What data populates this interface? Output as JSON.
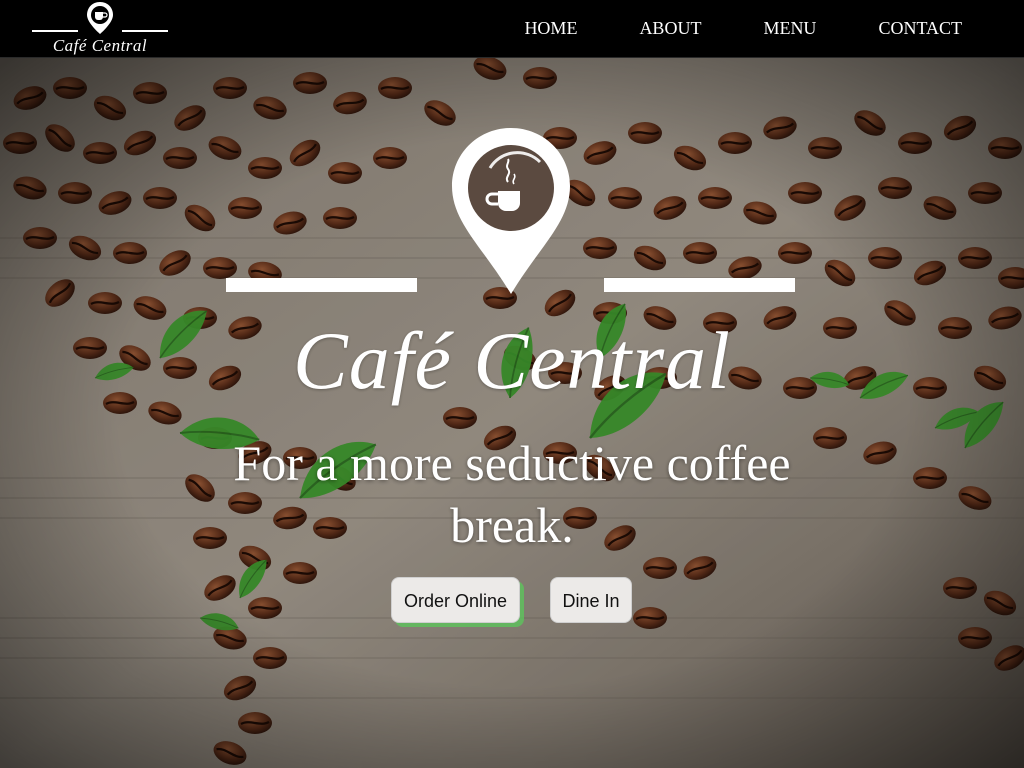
{
  "nav": {
    "logo_text": "Café Central",
    "links": [
      {
        "label": "HOME"
      },
      {
        "label": "ABOUT"
      },
      {
        "label": "MENU"
      },
      {
        "label": "CONTACT"
      }
    ]
  },
  "hero": {
    "brand": "Café Central",
    "tagline": "For a more seductive coffee break.",
    "buttons": {
      "order_label": "Order Online",
      "dine_label": "Dine In"
    },
    "logo_icon": "location-pin-coffee-cup-icon",
    "background": "coffee-beans-world-map-image"
  },
  "colors": {
    "navbar_bg": "#000000",
    "nav_text": "#ffffff",
    "button_bg": "#eceae8",
    "button_accent_shadow": "#5ac85a"
  }
}
